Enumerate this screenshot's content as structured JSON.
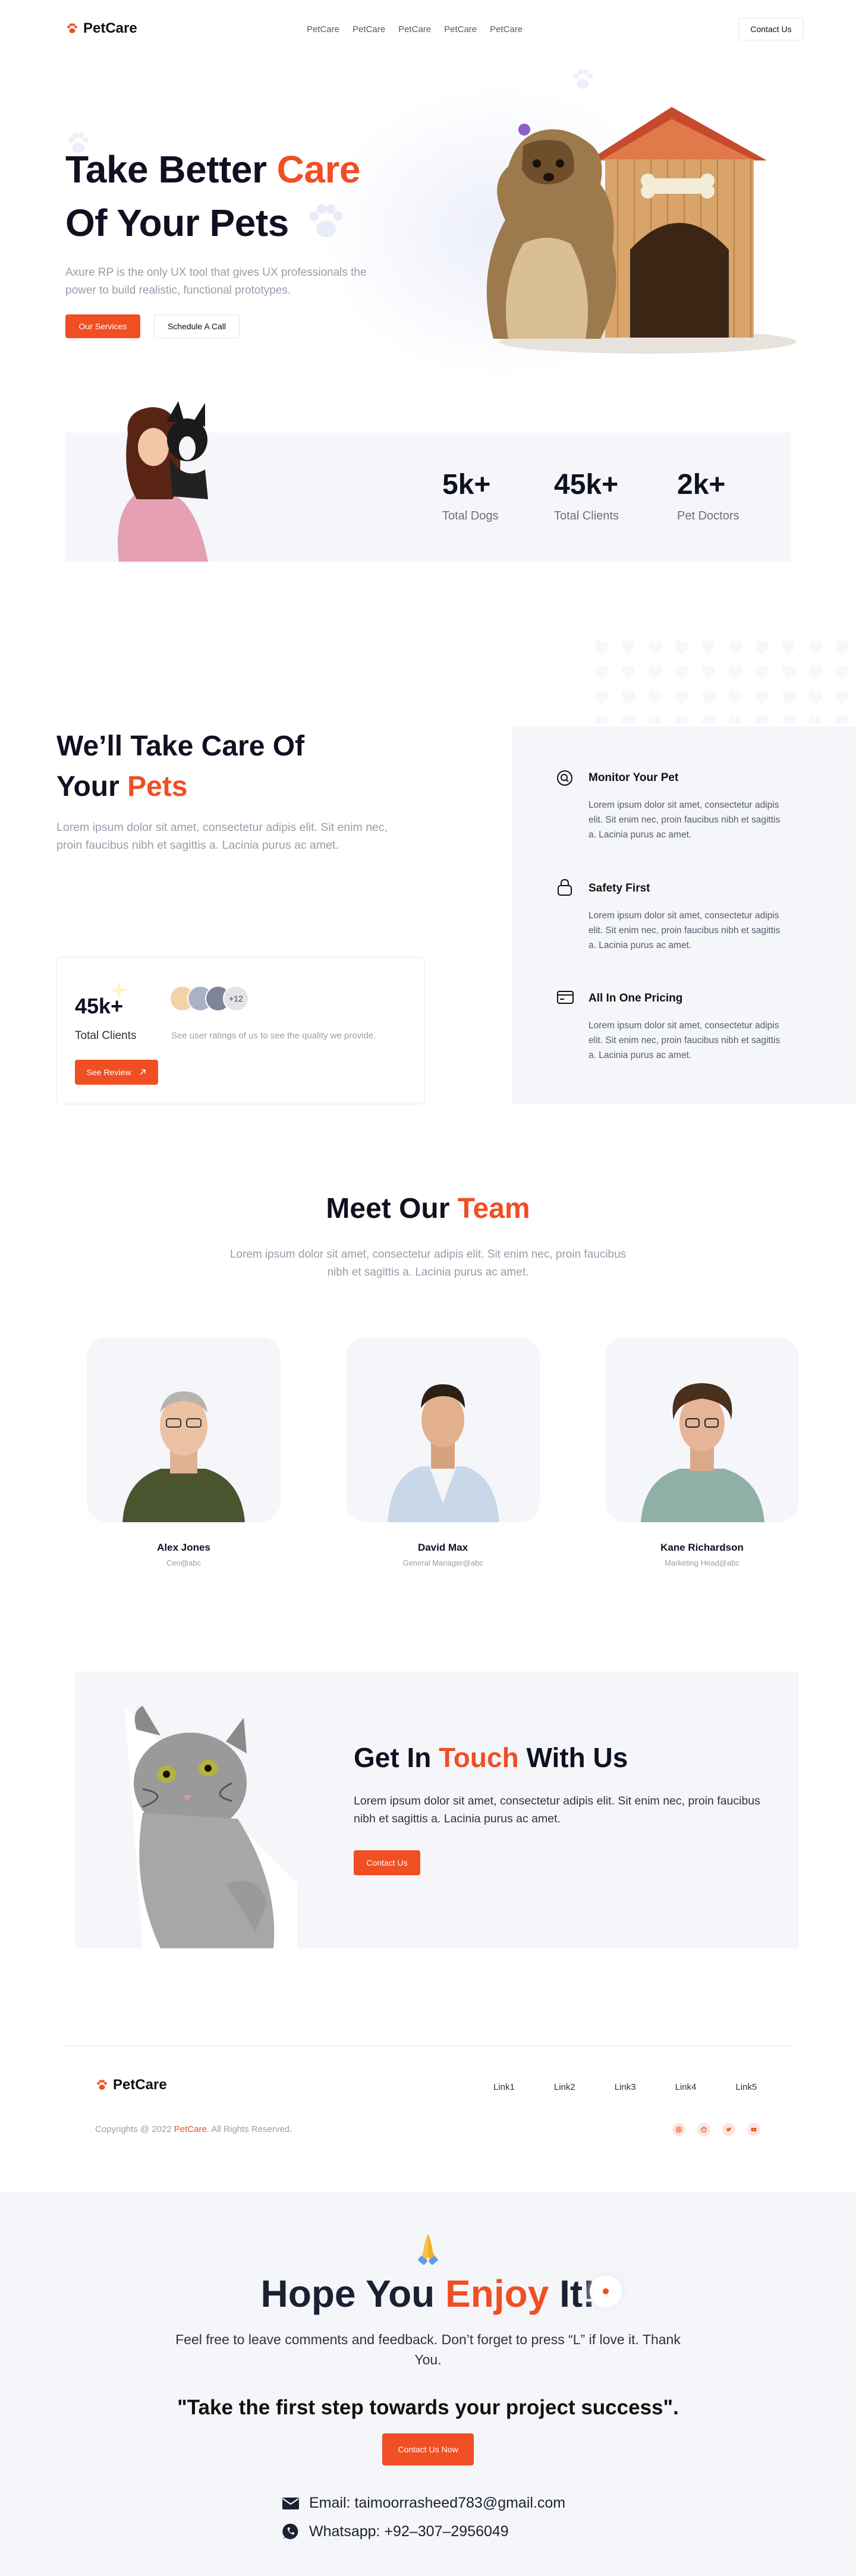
{
  "header": {
    "brand": "PetCare",
    "nav": [
      "PetCare",
      "PetCare",
      "PetCare",
      "PetCare",
      "PetCare"
    ],
    "contact_label": "Contact Us"
  },
  "hero": {
    "title_line1_pre": "Take Better ",
    "title_line1_accent": "Care",
    "title_line2": "Of Your Pets",
    "subtitle": "Axure RP is the only UX tool that gives UX professionals the power to build realistic, functional prototypes.",
    "primary_label": "Our Services",
    "secondary_label": "Schedule A Call"
  },
  "stats": [
    {
      "value": "5k+",
      "label": "Total Dogs"
    },
    {
      "value": "45k+",
      "label": "Total Clients"
    },
    {
      "value": "2k+",
      "label": "Pet Doctors"
    }
  ],
  "care": {
    "title_line1": "We’ll Take Care Of",
    "title_line2_pre": "Your ",
    "title_line2_accent": "Pets",
    "body": "Lorem ipsum dolor sit amet, consectetur adipis elit. Sit enim nec, proin faucibus nibh et sagittis a. Lacinia purus ac amet.",
    "review_card": {
      "value": "45k+",
      "label": "Total Clients",
      "avatar_more": "+12",
      "caption": "See user ratings of us to see the quality we provide.",
      "button_label": "See Review"
    },
    "features": [
      {
        "icon": "search-icon",
        "title": "Monitor Your Pet",
        "body": "Lorem ipsum dolor sit amet, consectetur adipis elit. Sit enim nec, proin faucibus nibh et sagittis a. Lacinia purus ac amet."
      },
      {
        "icon": "lock-icon",
        "title": "Safety First",
        "body": "Lorem ipsum dolor sit amet, consectetur adipis elit. Sit enim nec, proin faucibus nibh et sagittis a. Lacinia purus ac amet."
      },
      {
        "icon": "card-icon",
        "title": "All In One Pricing",
        "body": "Lorem ipsum dolor sit amet, consectetur adipis elit. Sit enim nec, proin faucibus nibh et sagittis a. Lacinia purus ac amet."
      }
    ]
  },
  "team": {
    "title_pre": "Meet Our ",
    "title_accent": "Team",
    "subtitle": "Lorem ipsum dolor sit amet, consectetur adipis elit. Sit enim nec, proin faucibus nibh et sagittis a. Lacinia purus ac amet.",
    "members": [
      {
        "name": "Alex Jones",
        "role": "Ceo@abc"
      },
      {
        "name": "David Max",
        "role": "General Manager@abc"
      },
      {
        "name": "Kane Richardson",
        "role": "Marketing Head@abc"
      }
    ]
  },
  "contact": {
    "title_pre": "Get In ",
    "title_accent": "Touch",
    "title_post": " With Us",
    "body": "Lorem ipsum dolor sit amet, consectetur adipis elit. Sit enim nec, proin faucibus nibh et sagittis a. Lacinia purus ac amet.",
    "button_label": "Contact Us"
  },
  "footer": {
    "brand": "PetCare",
    "links": [
      "Link1",
      "Link2",
      "Link3",
      "Link4",
      "Link5"
    ],
    "copyright_pre": "Copyrights @ 2022 ",
    "copyright_brand": "PetCare",
    "copyright_post": ". All Rights Reserved."
  },
  "thanks": {
    "title_pre": "Hope You ",
    "title_accent": "Enjoy",
    "title_post": " It!",
    "body": "Feel free to leave comments and feedback. Don’t forget to press  “L” if love it. Thank You.",
    "quote": "\"Take the first step towards your project success\".",
    "button_label": "Contact Us Now",
    "email": "Email: taimoorrasheed783@gmail.com",
    "whatsapp": "Whatsapp: +92–307–2956049"
  },
  "colors": {
    "accent": "#f04e23",
    "dark": "#0f1021",
    "panel": "#f5f6f9"
  }
}
